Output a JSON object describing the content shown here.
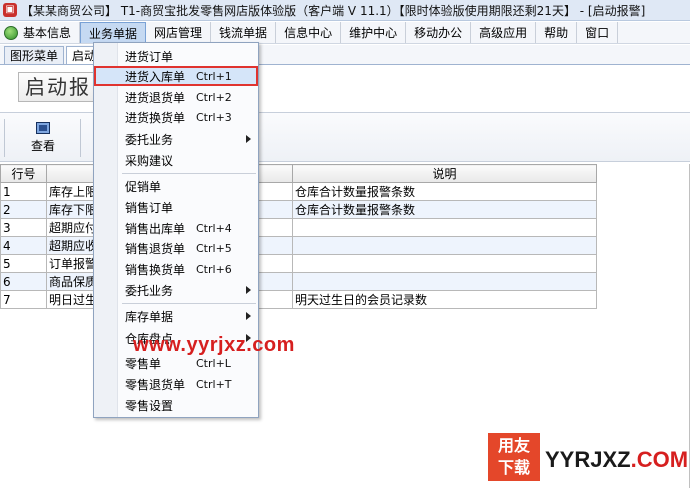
{
  "window": {
    "title": "【某某商贸公司】 T1-商贸宝批发零售网店版体验版（客户端 V 11.1）【限时体验版使用期限还剩21天】 - [启动报警]"
  },
  "menubar": {
    "items": [
      {
        "label": "基本信息"
      },
      {
        "label": "业务单据"
      },
      {
        "label": "网店管理"
      },
      {
        "label": "钱流单据"
      },
      {
        "label": "信息中心"
      },
      {
        "label": "维护中心"
      },
      {
        "label": "移动办公"
      },
      {
        "label": "高级应用"
      },
      {
        "label": "帮助"
      },
      {
        "label": "窗口"
      }
    ]
  },
  "tabs": [
    {
      "label": "图形菜单"
    },
    {
      "label": "启动"
    }
  ],
  "page": {
    "big_title": "启动报"
  },
  "toolbar": {
    "view_label": "查看"
  },
  "grid": {
    "columns": [
      "行号",
      "",
      "录数",
      "说明"
    ],
    "rows": [
      {
        "no": "1",
        "name": "库存上限",
        "count": "",
        "desc": "仓库合计数量报警条数"
      },
      {
        "no": "2",
        "name": "库存下限",
        "count": "",
        "desc": "仓库合计数量报警条数"
      },
      {
        "no": "3",
        "name": "超期应付",
        "count": "",
        "desc": ""
      },
      {
        "no": "4",
        "name": "超期应收",
        "count": "",
        "desc": ""
      },
      {
        "no": "5",
        "name": "订单报警",
        "count": "",
        "desc": ""
      },
      {
        "no": "6",
        "name": "商品保质",
        "count": "",
        "desc": ""
      },
      {
        "no": "7",
        "name": "明日过生",
        "count": "",
        "desc": "明天过生日的会员记录数"
      }
    ]
  },
  "dropdown": {
    "items": [
      {
        "label": "进货订单",
        "shortcut": ""
      },
      {
        "label": "进货入库单",
        "shortcut": "Ctrl+1"
      },
      {
        "label": "进货退货单",
        "shortcut": "Ctrl+2"
      },
      {
        "label": "进货换货单",
        "shortcut": "Ctrl+3"
      },
      {
        "label": "委托业务",
        "shortcut": ""
      },
      {
        "label": "采购建议",
        "shortcut": ""
      },
      {
        "label": "促销单",
        "shortcut": ""
      },
      {
        "label": "销售订单",
        "shortcut": ""
      },
      {
        "label": "销售出库单",
        "shortcut": "Ctrl+4"
      },
      {
        "label": "销售退货单",
        "shortcut": "Ctrl+5"
      },
      {
        "label": "销售换货单",
        "shortcut": "Ctrl+6"
      },
      {
        "label": "委托业务",
        "shortcut": ""
      },
      {
        "label": "库存单据",
        "shortcut": ""
      },
      {
        "label": "仓库盘点",
        "shortcut": ""
      },
      {
        "label": "零售单",
        "shortcut": "Ctrl+L"
      },
      {
        "label": "零售退货单",
        "shortcut": "Ctrl+T"
      },
      {
        "label": "零售设置",
        "shortcut": ""
      }
    ]
  },
  "watermark": {
    "url": "www.yyrjxz.com",
    "badge_line1": "用友",
    "badge_line2": "下载",
    "site_part1": "YYRJXZ",
    "site_part2": ".COM"
  },
  "colors": {
    "highlight_border": "#e0332f",
    "highlight_bg": "#d5e5f9",
    "menu_active_bg": "#c5d9f2",
    "watermark_red": "#d61f1f"
  }
}
